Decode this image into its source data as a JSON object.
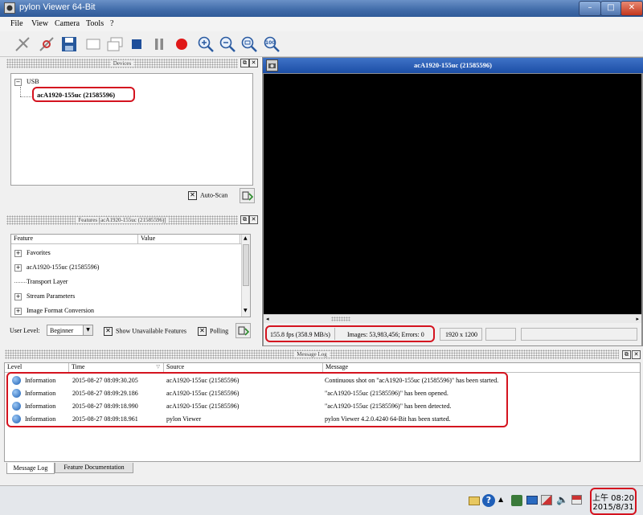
{
  "window": {
    "title": "pylon Viewer 64-Bit",
    "min": "–",
    "max": "□",
    "close": "✕"
  },
  "menu": [
    "File",
    "View",
    "Camera",
    "Tools",
    "?"
  ],
  "toolbar_icons": [
    "connect-icon",
    "disconnect-icon",
    "save-icon",
    "single-shot-icon",
    "continuous-shot-icon",
    "stop-icon",
    "pause-icon",
    "record-icon",
    "zoom-in-icon",
    "zoom-out-icon",
    "zoom-fit-icon",
    "zoom-100-icon"
  ],
  "zoom100_label": "100",
  "devices": {
    "title": "Devices",
    "root": "USB",
    "device": "acA1920-155uc (21585596)",
    "autoscan": "Auto-Scan"
  },
  "features": {
    "title": "Features [acA1920-155uc (21585596)]",
    "columns": [
      "Feature",
      "Value"
    ],
    "items": [
      "Favorites",
      "acA1920-155uc (21585596)",
      "Transport Layer",
      "Stream Parameters",
      "Image Format Conversion"
    ],
    "user_level_label": "User Level:",
    "user_level_value": "Beginner",
    "show_unavailable": "Show Unavailable Features",
    "polling": "Polling"
  },
  "image_window": {
    "title": "acA1920-155uc (21585596)",
    "status": {
      "fps": "155.8 fps (358.9 MB/s)",
      "images": "Images: 53,983,456; Errors: 0",
      "resolution": "1920 x 1200"
    }
  },
  "log": {
    "title": "Message Log",
    "columns": [
      "Level",
      "Time",
      "Source",
      "Message"
    ],
    "rows": [
      {
        "level": "Information",
        "time": "2015-08-27 08:09:30.205",
        "source": "acA1920-155uc (21585596)",
        "message": "Continuous shot on \"acA1920-155uc (21585596)\" has been started."
      },
      {
        "level": "Information",
        "time": "2015-08-27 08:09:29.186",
        "source": "acA1920-155uc (21585596)",
        "message": "\"acA1920-155uc (21585596)\" has been opened."
      },
      {
        "level": "Information",
        "time": "2015-08-27 08:09:18.990",
        "source": "acA1920-155uc (21585596)",
        "message": "\"acA1920-155uc (21585596)\" has been detected."
      },
      {
        "level": "Information",
        "time": "2015-08-27 08:09:18.961",
        "source": "pylon Viewer",
        "message": "pylon Viewer 4.2.0.4240 64-Bit has been started."
      }
    ],
    "tabs": [
      "Message Log",
      "Feature Documentation"
    ]
  },
  "taskbar": {
    "time": "上午 08:20",
    "date": "2015/8/31"
  },
  "colors": {
    "highlight": "#d4131f",
    "title_bar": "#3f6aa8",
    "image_bg": "#000000"
  }
}
